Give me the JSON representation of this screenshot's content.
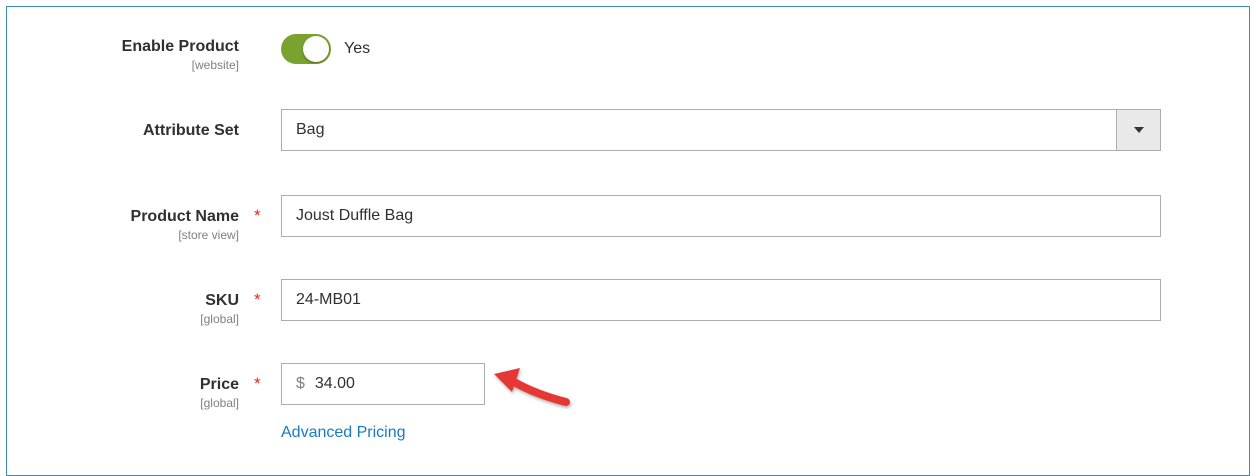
{
  "form": {
    "enable_product": {
      "label": "Enable Product",
      "scope": "[website]",
      "value": "Yes",
      "enabled": true
    },
    "attribute_set": {
      "label": "Attribute Set",
      "value": "Bag"
    },
    "product_name": {
      "label": "Product Name",
      "scope": "[store view]",
      "required_marker": "*",
      "value": "Joust Duffle Bag"
    },
    "sku": {
      "label": "SKU",
      "scope": "[global]",
      "required_marker": "*",
      "value": "24-MB01"
    },
    "price": {
      "label": "Price",
      "scope": "[global]",
      "required_marker": "*",
      "currency": "$",
      "value": "34.00",
      "link": "Advanced Pricing"
    }
  },
  "colors": {
    "toggle_on": "#79a22e",
    "required": "#e22626",
    "link": "#1979c3",
    "annotation_arrow": "#e53935",
    "frame_border": "#3e87c4"
  },
  "icons": {
    "select_caret": "chevron-down-icon",
    "annotation": "arrow-annotation-icon"
  }
}
